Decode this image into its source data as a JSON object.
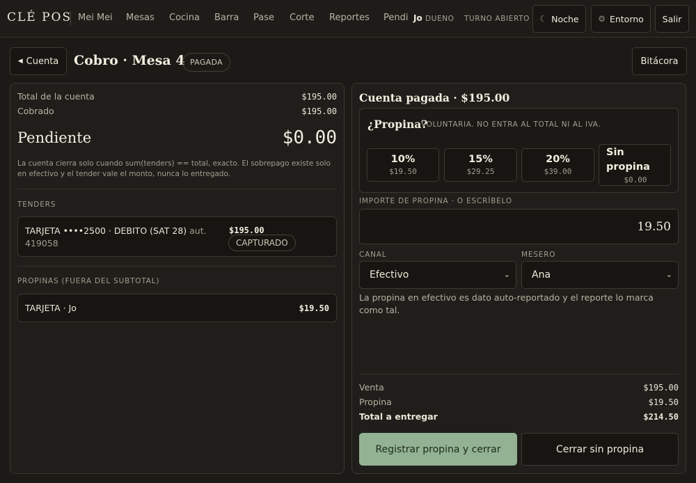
{
  "app": {
    "brand": "CLÉ POS",
    "nav": [
      "Mei Mei",
      "Mesas",
      "Cocina",
      "Barra",
      "Pase",
      "Corte",
      "Reportes",
      "Pendi"
    ],
    "user_name": "Jo",
    "user_role": "DUENO",
    "shift_status": "TURNO ABIERTO",
    "theme_button": "Noche",
    "theme_icon": "moon-icon",
    "env_button": "Entorno",
    "env_icon": "gear-icon",
    "logout_button": "Salir"
  },
  "header": {
    "back_label": "Cuenta",
    "title": "Cobro · Mesa 4",
    "status_badge": "PAGADA",
    "log_button": "Bitácora"
  },
  "summary": {
    "total_label": "Total de la cuenta",
    "total_value": "$195.00",
    "collected_label": "Cobrado",
    "collected_value": "$195.00",
    "pending_label": "Pendiente",
    "pending_value": "$0.00",
    "note": "La cuenta cierra solo cuando sum(tenders) == total, exacto. El sobrepago existe solo en efectivo y el tender vale el monto, nunca lo entregado."
  },
  "tenders": {
    "section_label": "TENDERS",
    "items": [
      {
        "description": "TARJETA ••••2500 · DEBITO (SAT 28)",
        "auth_label": "aut.",
        "auth_code": "419058",
        "amount": "$195.00",
        "status": "CAPTURADO"
      }
    ]
  },
  "tips_list": {
    "section_label": "PROPINAS (FUERA DEL SUBTOTAL)",
    "items": [
      {
        "description": "TARJETA · Jo",
        "amount": "$19.50"
      }
    ]
  },
  "right": {
    "title": "Cuenta pagada · $195.00",
    "tip_question": "¿Propina?",
    "tip_hint": "VOLUNTARIA. NO ENTRA AL TOTAL NI AL IVA.",
    "tip_options": [
      {
        "label": "10%",
        "amount": "$19.50"
      },
      {
        "label": "15%",
        "amount": "$29.25"
      },
      {
        "label": "20%",
        "amount": "$39.00"
      },
      {
        "label": "Sin propina",
        "amount": "$0.00"
      }
    ],
    "amount_label": "IMPORTE DE PROPINA · O ESCRÍBELO",
    "amount_value": "19.50",
    "channel_label": "CANAL",
    "channel_value": "Efectivo",
    "waiter_label": "MESERO",
    "waiter_value": "Ana",
    "cash_note": "La propina en efectivo es dato auto-reportado y el reporte lo marca como tal.",
    "sale_label": "Venta",
    "sale_value": "$195.00",
    "tip_label": "Propina",
    "tip_value": "$19.50",
    "deliver_label": "Total a entregar",
    "deliver_value": "$214.50",
    "primary_button": "Registrar propina y cerrar",
    "secondary_button": "Cerrar sin propina"
  }
}
